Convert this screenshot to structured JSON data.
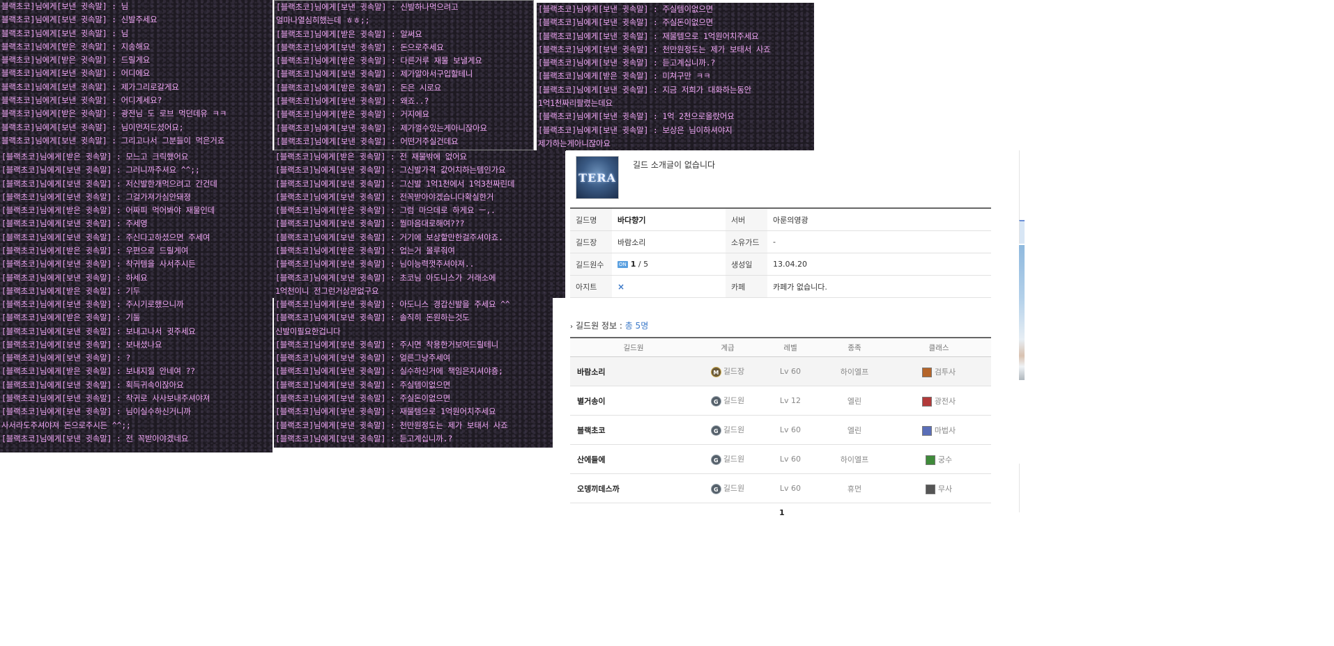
{
  "chat_panels": [
    {
      "lines": [
        "블랙초코]님에게[보낸 귓속말] : 님",
        "블랙초코]님에게[보낸 귓속말] : 신발주세요",
        "블랙초코]님에게[보낸 귓속말] : 님",
        "블랙초코]님에게[받은 귓속말] : 지송해요",
        "블랙초코]님에게[받은 귓속말] : 드릴게요",
        "블랙초코]님에게[보낸 귓속말] : 어디에요",
        "블랙초코]님에게[보낸 귓속말] : 제가그리로갈게요",
        "블랙초코]님에게[보낸 귓속말] : 어디계세요?",
        "블랙초코]님에게[받은 귓속말] : 광전님 도 로브 먹던데유 ㅋㅋ",
        "블랙초코]님에게[보낸 귓속말] : 님이먼저드셨어요;",
        "블랙초코]님에게[보낸 귓속말] : 그리고나서 그분들이 먹은거죠"
      ]
    },
    {
      "lines": [
        "[블랙초코]님에게[보낸 귓속말] : 신발하나먹으려고",
        "얼마나열심히했는데 ㅎㅎ;;",
        "[블랙초코]님에게[받은 귓속말] : 알써요",
        "[블랙초코]님에게[보낸 귓속말] : 돈으로주세요",
        "[블랙초코]님에게[받은 귓속말] : 다른거루 재물 보낼게요",
        "[블랙초코]님에게[보낸 귓속말] : 제가알아서구입할테니",
        "[블랙초코]님에게[받은 귓속말] : 돈은 시로요",
        "[블랙초코]님에게[보낸 귓속말] : 왜죠..?",
        "[블랙초코]님에게[받은 귓속말] : 거지에요",
        "[블랙초코]님에게[보낸 귓속말] : 제가껄수있는게아니잖아요",
        "[블랙초코]님에게[보낸 귓속말] : 어떤거주실건데요"
      ]
    },
    {
      "lines": [
        "[블랙초코]님에게[보낸 귓속말] : 주실템이없으면",
        "[블랙초코]님에게[보낸 귓속말] : 주실돈이없으면",
        "[블랙초코]님에게[보낸 귓속말] : 재물템으로 1억원어치주세요",
        "[블랙초코]님에게[보낸 귓속말] : 천만원정도는 제가 보태서 사죠",
        "[블랙초코]님에게[보낸 귓속말] : 듣고계십니까.?",
        "[블랙초코]님에게[받은 귓속말] : 미쳐구만 ㅋㅋ",
        "[블랙초코]님에게[보낸 귓속말] : 지금 저희가 대화하는동안",
        "1억1천짜리팔렸는데요",
        "[블랙초코]님에게[보낸 귓속말] : 1억 2천으로올랐어요",
        "[블랙초코]님에게[보낸 귓속말] : 보상은 님이하셔야지",
        "제가하는게아니잖아요"
      ]
    },
    {
      "lines": [
        "[블랙초코]님에게[받은 귓속말] : 모느고 크릭했어요",
        "[블랙초코]님에게[보낸 귓속말] : 그러니까주셔요 ^^;;",
        "[블랙초코]님에게[보낸 귓속말] : 저신발한개먹으려고 간건데",
        "[블랙초코]님에게[보낸 귓속말] : 그걸가져가심안돼졍",
        "[블랙초코]님에게[받은 귓속말] : 어짜피 먹어봐야 재물인데",
        "[블랙초코]님에게[보낸 귓속말] : 주세영",
        "[블랙초코]님에게[보낸 귓속말] : 주신다고하셨으면 주세여",
        "[블랙초코]님에게[받은 귓속말] : 우편으로 드릴게여",
        "[블랙초코]님에게[보낸 귓속말] : 착귀템을 사서주시든",
        "[블랙초코]님에게[보낸 귓속말] : 하세요",
        "[블랙초코]님에게[받은 귓속말] : 기두"
      ]
    },
    {
      "lines": [
        "[블랙초코]님에게[받은 귓속말] : 전 재물밖에 없어요",
        "[블랙초코]님에게[보낸 귓속말] : 그신발가격 값어치하는템인가요",
        "[블랙초코]님에게[보낸 귓속말] : 그신발 1억1천에서 1억3천짜린데",
        "[블랙초코]님에게[보낸 귓속말] : 전꼭받아야겠습니다확실한거",
        "[블랙초코]님에게[받은 귓속말] : 그럼 마으데로 하게요 ㅡ,.",
        "[블랙초코]님에게[보낸 귓속말] : 뭘마음대로해여???",
        "[블랙초코]님에게[보낸 귓속말] : 거기에 보상할만한걸주셔야죠.",
        "[블랙초코]님에게[받은 귓속말] : 업는거 몰루줘여",
        "[블랙초코]님에게[보낸 귓속말] : 님이능력껏주셔야져..",
        "[블랙초코]님에게[보낸 귓속말] : 초코님 아도니스가 거래소에",
        "1억천이니 전그런거상관없구요"
      ]
    },
    {
      "lines": [
        "[블랙초코]님에게[보낸 귓속말] : 주시기로했으니까",
        "[블랙초코]님에게[받은 귓속말] : 기둘",
        "[블랙초코]님에게[보낸 귓속말] : 보내고나서 귓주세요",
        "[블랙초코]님에게[보낸 귓속말] : 보내셨나요",
        "[블랙초코]님에게[보낸 귓속말] : ?",
        "[블랙초코]님에게[받은 귓속말] : 보내지질 안네여 ??",
        "[블랙초코]님에게[보낸 귓속말] : 획득귀속이잖아요",
        "[블랙초코]님에게[보낸 귓속말] : 착귀로 사사보내주셔야져",
        "[블랙초코]님에게[보낸 귓속말] : 님이실수하신거니까",
        "사서라도주셔야져 돈으로주시든 ^^;;",
        "[블랙초코]님에게[보낸 귓속말] : 전 꼭받아야겠네요"
      ]
    },
    {
      "lines": [
        "[블랙초코]님에게[보낸 귓속말] : 아도니스 경갑신발을 주세요 ^^",
        "[블랙초코]님에게[보낸 귓속말] : 솔직히 돈원하는것도",
        "신발이필요한겁니다",
        "[블랙초코]님에게[보낸 귓속말] : 주시면 착용한거보여드릴테니",
        "[블랙초코]님에게[보낸 귓속말] : 얼른그냥주세여",
        "[블랙초코]님에게[보낸 귓속말] : 실수하신거에 책임은지셔야죵;",
        "[블랙초코]님에게[보낸 귓속말] : 주실템이없으면",
        "[블랙초코]님에게[보낸 귓속말] : 주실돈이없으면",
        "[블랙초코]님에게[보낸 귓속말] : 재물템으로 1억원어치주세요",
        "[블랙초코]님에게[보낸 귓속말] : 천만원정도는 제가 보태서 사죠",
        "[블랙초코]님에게[보낸 귓속말] : 듣고계십니까.?"
      ]
    }
  ],
  "guild": {
    "logo_text": "TERA",
    "intro": "길드 소개글이 없습니다",
    "info": {
      "name_label": "길드명",
      "name_value": "바다향기",
      "server_label": "서버",
      "server_value": "아룬의영광",
      "master_label": "길드장",
      "master_value": "바람소리",
      "guard_label": "소유가드",
      "guard_value": "-",
      "members_label": "길드원수",
      "members_badge": "ON",
      "members_online": "1",
      "members_sep": "/",
      "members_total": "5",
      "created_label": "생성일",
      "created_value": "13.04.20",
      "hideout_label": "아지트",
      "hideout_value": "×",
      "cafe_label": "카페",
      "cafe_value": "카페가 없습니다."
    },
    "members_heading": {
      "arrow": "›",
      "label": "길드원 정보 :",
      "count": "총 5명"
    },
    "members_columns": [
      "길드원",
      "계급",
      "레벨",
      "종족",
      "클래스"
    ],
    "members": [
      {
        "name": "바람소리",
        "rank_icon": "M",
        "rank": "길드장",
        "level": "Lv 60",
        "race": "하이엘프",
        "class": "검투사",
        "class_color": "#b5652a"
      },
      {
        "name": "별거송이",
        "rank_icon": "G",
        "rank": "길드원",
        "level": "Lv 12",
        "race": "엘린",
        "class": "광전사",
        "class_color": "#b23a3a"
      },
      {
        "name": "블랙초코",
        "rank_icon": "G",
        "rank": "길드원",
        "level": "Lv 60",
        "race": "엘린",
        "class": "마법사",
        "class_color": "#5a6eb8"
      },
      {
        "name": "산에들에",
        "rank_icon": "G",
        "rank": "길드원",
        "level": "Lv 60",
        "race": "하이엘프",
        "class": "궁수",
        "class_color": "#3f8a3a"
      },
      {
        "name": "오뎅끼데스까",
        "rank_icon": "G",
        "rank": "길드원",
        "level": "Lv 60",
        "race": "휴먼",
        "class": "무사",
        "class_color": "#555555"
      }
    ],
    "pager": "1"
  },
  "colors": {
    "chat_text": "#f0a6f5",
    "chat_bg": "#1e1a22",
    "link_blue": "#3a78c8"
  }
}
